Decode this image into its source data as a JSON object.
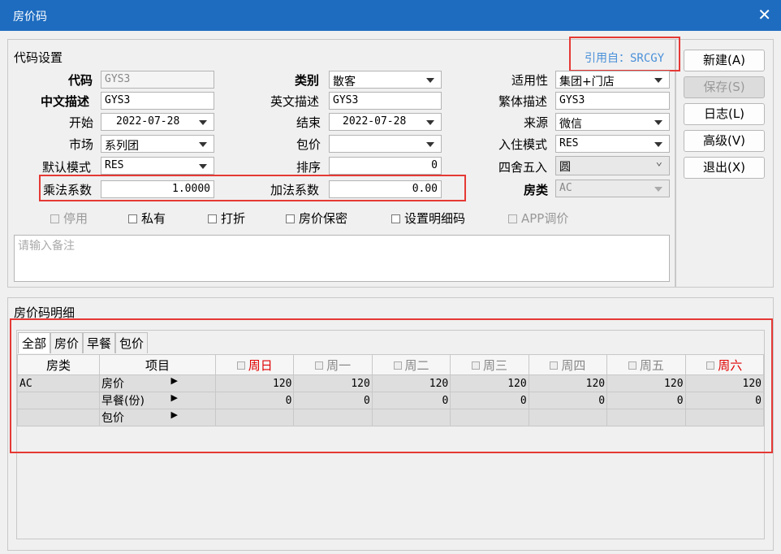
{
  "window": {
    "title": "房价码",
    "close_label": "✕"
  },
  "settings": {
    "section_title": "代码设置",
    "reference_text": "引用自：SRCGY",
    "code": {
      "label": "代码",
      "value": "GYS3"
    },
    "category": {
      "label": "类别",
      "value": "散客"
    },
    "applicability": {
      "label": "适用性",
      "value": "集团+门店"
    },
    "cn_desc": {
      "label": "中文描述",
      "value": "GYS3"
    },
    "en_desc": {
      "label": "英文描述",
      "value": "GYS3"
    },
    "tw_desc": {
      "label": "繁体描述",
      "value": "GYS3"
    },
    "start": {
      "label": "开始",
      "value": "2022-07-28"
    },
    "end": {
      "label": "结束",
      "value": "2022-07-28"
    },
    "source": {
      "label": "来源",
      "value": "微信"
    },
    "market": {
      "label": "市场",
      "value": "系列团"
    },
    "package": {
      "label": "包价",
      "value": ""
    },
    "checkin_mode": {
      "label": "入住模式",
      "value": "RES"
    },
    "default_mode": {
      "label": "默认模式",
      "value": "RES"
    },
    "sort": {
      "label": "排序",
      "value": "0"
    },
    "rounding": {
      "label": "四舍五入",
      "value": "圆"
    },
    "multiplier": {
      "label": "乘法系数",
      "value": "1.0000"
    },
    "addend": {
      "label": "加法系数",
      "value": "0.00"
    },
    "room_type": {
      "label": "房类",
      "value": "AC"
    },
    "checkboxes": {
      "disabled": "停用",
      "private": "私有",
      "discount": "打折",
      "confidential": "房价保密",
      "detail_code": "设置明细码",
      "app_price": "APP调价"
    },
    "remark_placeholder": "请输入备注"
  },
  "buttons": {
    "new": "新建(A)",
    "save": "保存(S)",
    "log": "日志(L)",
    "advanced": "高级(V)",
    "exit": "退出(X)"
  },
  "detail": {
    "section_title": "房价码明细",
    "tabs": [
      "全部",
      "房价",
      "早餐",
      "包价"
    ],
    "headers": {
      "room_type": "房类",
      "item": "项目",
      "days": [
        "周日",
        "周一",
        "周二",
        "周三",
        "周四",
        "周五",
        "周六"
      ]
    },
    "rows": [
      {
        "room_type": "AC",
        "item": "房价",
        "values": [
          "120",
          "120",
          "120",
          "120",
          "120",
          "120",
          "120"
        ]
      },
      {
        "room_type": "",
        "item": "早餐(份)",
        "values": [
          "0",
          "0",
          "0",
          "0",
          "0",
          "0",
          "0"
        ]
      },
      {
        "room_type": "",
        "item": "包价",
        "values": [
          "",
          "",
          "",
          "",
          "",
          "",
          ""
        ]
      }
    ]
  },
  "colors": {
    "title_bar": "#1e6cc0",
    "highlight_border": "#e53935",
    "weekend": "#e00000",
    "reference": "#4a90d9"
  }
}
